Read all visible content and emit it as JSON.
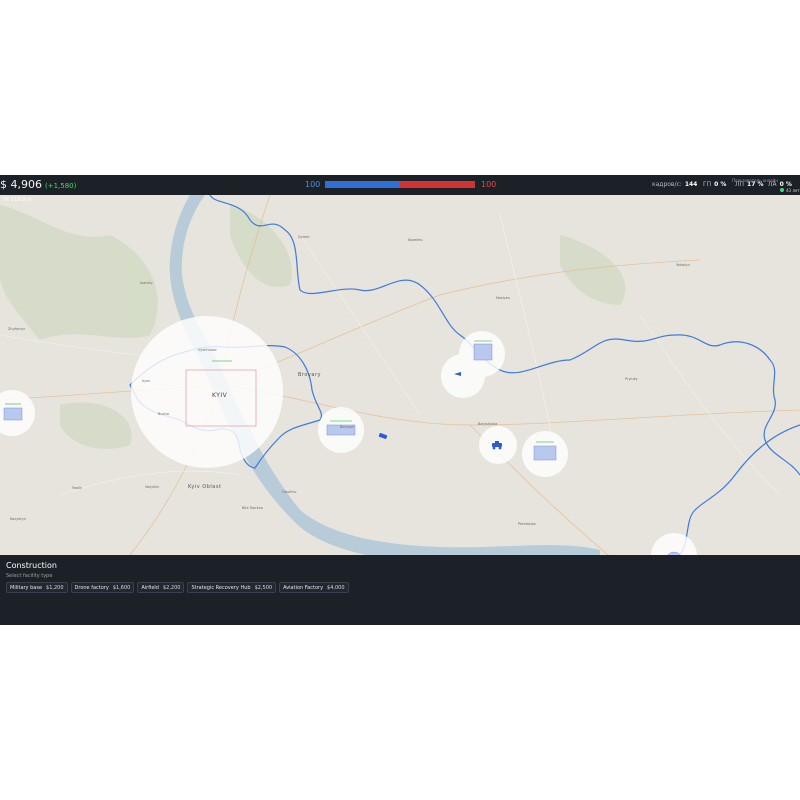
{
  "topbar": {
    "money": "$ 4,906",
    "income": "(+1,580)",
    "score_blue": "100",
    "score_red": "100",
    "recruits_label": "кадров/с",
    "recruits_value": "144",
    "gp_label": "ГП",
    "gp_value": "0 %",
    "lp_label": "ЛП",
    "lp_value": "17 %",
    "la_label": "ЛА",
    "la_value": "0 %",
    "legend_text": "Пользователь онлайн",
    "online_text": "43 лет"
  },
  "hud": {
    "height": "H: 119.0 m"
  },
  "map": {
    "city": "KYIV",
    "places": [
      "Ivankiv",
      "Dymer",
      "Kozelets",
      "Nosivka",
      "Zhytomyr",
      "Brovary",
      "Boryspil",
      "Bila Tserkva",
      "Pryluky",
      "Baryshivka",
      "Obukhiv",
      "Vyshhorod",
      "Irpin",
      "Bucha",
      "Vasylkiv",
      "Fastiv",
      "Kozyatyn",
      "Yahotyn",
      "Pereiaslav",
      "Kyiv Oblast"
    ],
    "colors": {
      "friendly_border": "#3d7be0",
      "enemy_unit": "#2d5bd6",
      "fog_circle": "#ffffff",
      "water": "#b7cbd8",
      "land": "#e6e4dc"
    },
    "units": [
      {
        "icon": "truck-icon"
      },
      {
        "icon": "armor-icon"
      },
      {
        "icon": "drone-icon"
      }
    ]
  },
  "construction": {
    "title": "Construction",
    "subtitle": "Select facility type",
    "items": [
      {
        "name": "Military base",
        "price": "$1,200"
      },
      {
        "name": "Drone factory",
        "price": "$1,600"
      },
      {
        "name": "Airfield",
        "price": "$2,200"
      },
      {
        "name": "Strategic Recovery Hub",
        "price": "$2,500"
      },
      {
        "name": "Aviation Factory",
        "price": "$4,000"
      }
    ]
  }
}
